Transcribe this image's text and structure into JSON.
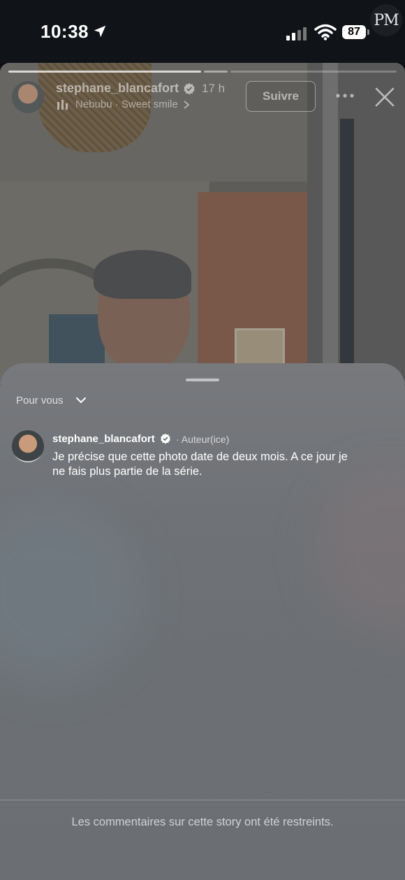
{
  "status_bar": {
    "time": "10:38",
    "battery": "87",
    "watermark": "PM"
  },
  "story": {
    "username": "stephane_blancafort",
    "time_ago": "17 h",
    "music": "Nebubu · Sweet smile",
    "follow_label": "Suivre"
  },
  "comments": {
    "filter_label": "Pour vous",
    "items": [
      {
        "username": "stephane_blancafort",
        "role": "· Auteur(ice)",
        "text": "Je précise que cette photo date de deux mois. A ce jour je ne fais plus partie de la série."
      }
    ],
    "restricted_notice": "Les commentaires sur cette story ont été restreints."
  }
}
